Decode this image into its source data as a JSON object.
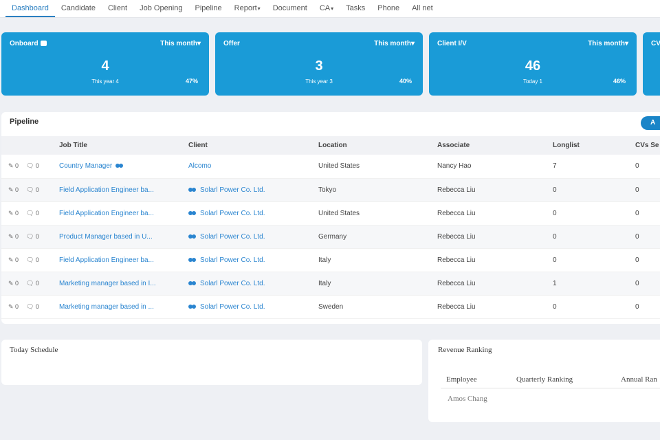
{
  "nav": {
    "tabs": [
      {
        "label": "Dashboard",
        "active": true
      },
      {
        "label": "Candidate"
      },
      {
        "label": "Client"
      },
      {
        "label": "Job Opening"
      },
      {
        "label": "Pipeline"
      },
      {
        "label": "Report",
        "caret": "▾"
      },
      {
        "label": "Document"
      },
      {
        "label": "CA",
        "caret": "▾"
      },
      {
        "label": "Tasks"
      },
      {
        "label": "Phone"
      },
      {
        "label": "All net"
      }
    ]
  },
  "cards": [
    {
      "title": "Onboard",
      "period": "This month▾",
      "value": "4",
      "sub": "This year 4",
      "pct": "47%"
    },
    {
      "title": "Offer",
      "period": "This month▾",
      "value": "3",
      "sub": "This year 3",
      "pct": "40%"
    },
    {
      "title": "Client I/V",
      "period": "This month▾",
      "value": "46",
      "sub": "Today 1",
      "pct": "46%"
    },
    {
      "title": "CV",
      "period": "",
      "value": "",
      "sub": "",
      "pct": ""
    }
  ],
  "pipeline": {
    "title": "Pipeline",
    "add_label": "A",
    "columns": [
      "Job Title",
      "Client",
      "Location",
      "Associate",
      "Longlist",
      "CVs Se"
    ],
    "rows": [
      {
        "a1": "✎ 0",
        "a2": "🗨 0",
        "job": "Country Manager",
        "client": "Alcomo",
        "location": "United States",
        "associate": "Nancy Hao",
        "longlist": "7",
        "cvs": "0"
      },
      {
        "a1": "✎ 0",
        "a2": "🗨 0",
        "job": "Field Application Engineer ba...",
        "client": "Solarl Power Co. Ltd.",
        "location": "Tokyo",
        "associate": "Rebecca Liu",
        "longlist": "0",
        "cvs": "0"
      },
      {
        "a1": "✎ 0",
        "a2": "🗨 0",
        "job": "Field Application Engineer ba...",
        "client": "Solarl Power Co. Ltd.",
        "location": "United States",
        "associate": "Rebecca Liu",
        "longlist": "0",
        "cvs": "0"
      },
      {
        "a1": "✎ 0",
        "a2": "🗨 0",
        "job": "Product Manager based in U...",
        "client": "Solarl Power Co. Ltd.",
        "location": "Germany",
        "associate": "Rebecca Liu",
        "longlist": "0",
        "cvs": "0"
      },
      {
        "a1": "✎ 0",
        "a2": "🗨 0",
        "job": "Field Application Engineer ba...",
        "client": "Solarl Power Co. Ltd.",
        "location": "Italy",
        "associate": "Rebecca Liu",
        "longlist": "0",
        "cvs": "0"
      },
      {
        "a1": "✎ 0",
        "a2": "🗨 0",
        "job": "Marketing manager based in I...",
        "client": "Solarl Power Co. Ltd.",
        "location": "Italy",
        "associate": "Rebecca Liu",
        "longlist": "1",
        "cvs": "0"
      },
      {
        "a1": "✎ 0",
        "a2": "🗨 0",
        "job": "Marketing manager based in ...",
        "client": "Solarl Power Co. Ltd.",
        "location": "Sweden",
        "associate": "Rebecca Liu",
        "longlist": "0",
        "cvs": "0"
      }
    ]
  },
  "schedule": {
    "title": "Today Schedule"
  },
  "revenue": {
    "title": "Revenue Ranking",
    "headers": [
      "Employee",
      "Quarterly Ranking",
      "Annual Ran"
    ],
    "employee": "Amos Chang"
  },
  "colors": {
    "accent": "#1a9bd7",
    "link": "#2a85d0"
  },
  "icons": {
    "card_title_icon": "gift-icon",
    "group_icon": "group-icon",
    "edit_icon": "edit-icon",
    "comment_icon": "comment-icon"
  }
}
